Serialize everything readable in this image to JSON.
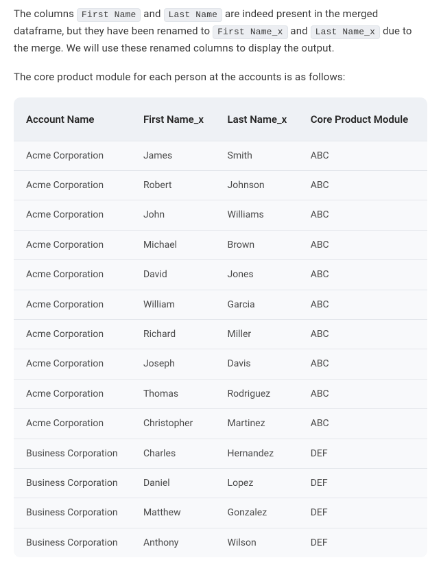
{
  "paragraphs": {
    "p1_parts": [
      {
        "type": "text",
        "value": "The columns "
      },
      {
        "type": "code",
        "value": "First Name"
      },
      {
        "type": "text",
        "value": " and "
      },
      {
        "type": "code",
        "value": "Last Name"
      },
      {
        "type": "text",
        "value": " are indeed present in the merged dataframe, but they have been renamed to "
      },
      {
        "type": "code",
        "value": "First Name_x"
      },
      {
        "type": "text",
        "value": " and "
      },
      {
        "type": "code",
        "value": "Last Name_x"
      },
      {
        "type": "text",
        "value": " due to the merge. We will use these renamed columns to display the output."
      }
    ],
    "p2": "The core product module for each person at the accounts is as follows:"
  },
  "table": {
    "headers": [
      "Account Name",
      "First Name_x",
      "Last Name_x",
      "Core Product Module"
    ],
    "rows": [
      [
        "Acme Corporation",
        "James",
        "Smith",
        "ABC"
      ],
      [
        "Acme Corporation",
        "Robert",
        "Johnson",
        "ABC"
      ],
      [
        "Acme Corporation",
        "John",
        "Williams",
        "ABC"
      ],
      [
        "Acme Corporation",
        "Michael",
        "Brown",
        "ABC"
      ],
      [
        "Acme Corporation",
        "David",
        "Jones",
        "ABC"
      ],
      [
        "Acme Corporation",
        "William",
        "Garcia",
        "ABC"
      ],
      [
        "Acme Corporation",
        "Richard",
        "Miller",
        "ABC"
      ],
      [
        "Acme Corporation",
        "Joseph",
        "Davis",
        "ABC"
      ],
      [
        "Acme Corporation",
        "Thomas",
        "Rodriguez",
        "ABC"
      ],
      [
        "Acme Corporation",
        "Christopher",
        "Martinez",
        "ABC"
      ],
      [
        "Business Corporation",
        "Charles",
        "Hernandez",
        "DEF"
      ],
      [
        "Business Corporation",
        "Daniel",
        "Lopez",
        "DEF"
      ],
      [
        "Business Corporation",
        "Matthew",
        "Gonzalez",
        "DEF"
      ],
      [
        "Business Corporation",
        "Anthony",
        "Wilson",
        "DEF"
      ]
    ]
  }
}
